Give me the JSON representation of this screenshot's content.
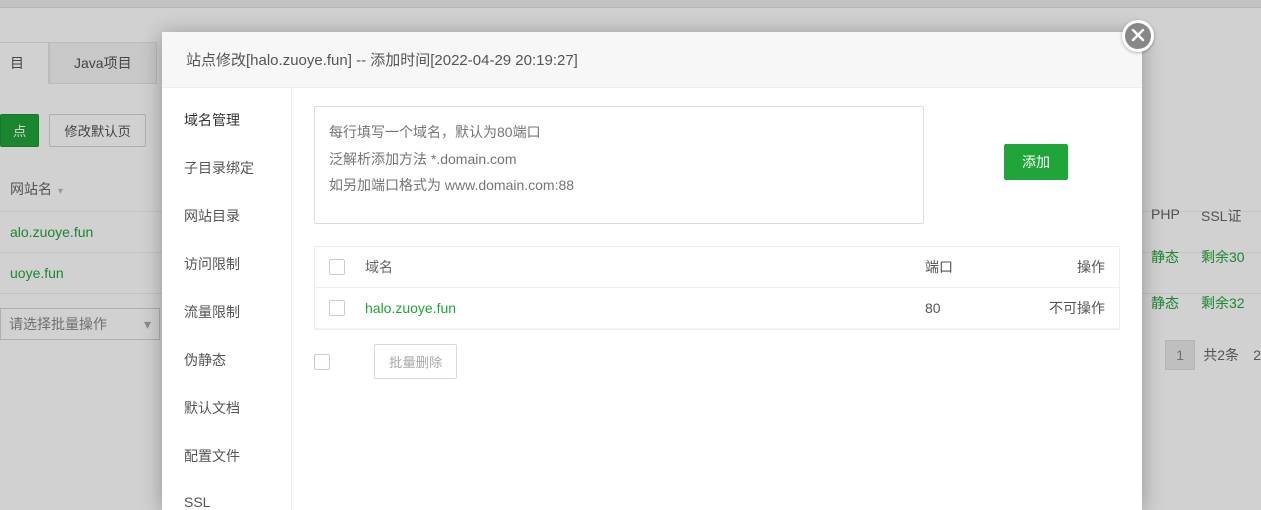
{
  "bg": {
    "tab1": "目",
    "tab2": "Java项目",
    "btn_add": "点",
    "btn_default": "修改默认页",
    "th_site": "网站名",
    "row1_site": "alo.zuoye.fun",
    "row2_site": "uoye.fun",
    "batch_placeholder": "请选择批量操作",
    "th_php": "PHP",
    "th_ssl": "SSL证",
    "php_val": "静态",
    "ssl_val1": "剩余30",
    "ssl_val2": "剩余32",
    "page_num": "1",
    "page_count": "共2条",
    "page_extra": "2"
  },
  "modal": {
    "title": "站点修改[halo.zuoye.fun] -- 添加时间[2022-04-29 20:19:27]",
    "sidebar": {
      "items": [
        "域名管理",
        "子目录绑定",
        "网站目录",
        "访问限制",
        "流量限制",
        "伪静态",
        "默认文档",
        "配置文件",
        "SSL"
      ]
    },
    "textarea_placeholder": "每行填写一个域名，默认为80端口\n泛解析添加方法 *.domain.com\n如另加端口格式为 www.domain.com:88",
    "add_btn": "添加",
    "table": {
      "th_domain": "域名",
      "th_port": "端口",
      "th_op": "操作",
      "row_domain": "halo.zuoye.fun",
      "row_port": "80",
      "row_op": "不可操作"
    },
    "batch_delete": "批量删除"
  }
}
